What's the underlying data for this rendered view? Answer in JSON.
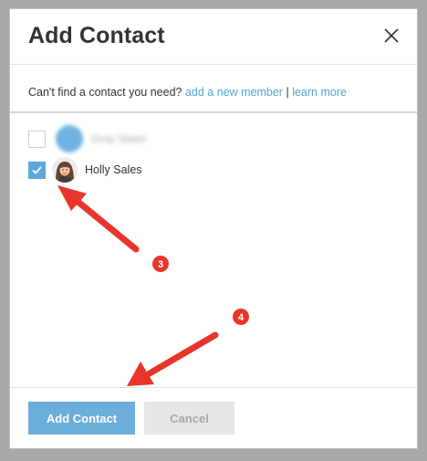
{
  "dialog": {
    "title": "Add Contact",
    "close_icon": "close-icon"
  },
  "hint": {
    "text": "Can't find a contact you need?",
    "add_link": "add a new member",
    "divider": "|",
    "learn_link": "learn more"
  },
  "contacts": [
    {
      "name": "Gray Slater",
      "checked": false,
      "blurred": true
    },
    {
      "name": "Holly Sales",
      "checked": true,
      "blurred": false
    }
  ],
  "footer": {
    "add_label": "Add Contact",
    "cancel_label": "Cancel"
  },
  "annotations": {
    "step_a": "3",
    "step_b": "4"
  },
  "colors": {
    "accent": "#5fa7d8",
    "link": "#53a6d2",
    "annotation": "#e8352b"
  }
}
